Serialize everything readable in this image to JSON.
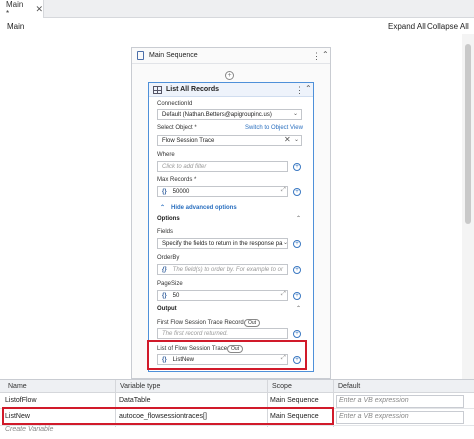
{
  "tab": {
    "label": "Main *",
    "close": "✕"
  },
  "header": {
    "breadcrumb": "Main",
    "expand_all": "Expand All",
    "collapse_all": "Collapse All"
  },
  "main_sequence": {
    "title": "Main Sequence",
    "more": "⋮",
    "collapse": "⌃"
  },
  "activity": {
    "title": "List All Records",
    "connection": {
      "label": "ConnectionId",
      "value": "Default (Nathan.Betters@apigroupinc.us)"
    },
    "select_object": {
      "label": "Select Object *",
      "switch_link": "Switch to Object View",
      "value": "Flow Session Trace"
    },
    "where": {
      "label": "Where",
      "placeholder": "Click to add filter"
    },
    "max_records": {
      "label": "Max Records *",
      "value": "50000"
    },
    "hide_advanced": "Hide advanced options",
    "options_section": "Options",
    "fields": {
      "label": "Fields",
      "value": "Specify the fields to return in the response pa"
    },
    "orderby": {
      "label": "OrderBy",
      "placeholder": "The field(s) to order by. For example to or"
    },
    "pagesize": {
      "label": "PageSize",
      "value": "50"
    },
    "output_section": "Output",
    "first_record": {
      "label": "First Flow Session Trace Record",
      "badge": "Out",
      "placeholder": "The first record returned."
    },
    "list_of": {
      "label": "List of Flow Session Trace",
      "badge": "Out",
      "value": "ListNew"
    }
  },
  "variables": {
    "columns": [
      "Name",
      "Variable type",
      "Scope",
      "Default"
    ],
    "rows": [
      {
        "name": "ListofFlow",
        "type": "DataTable",
        "scope": "Main Sequence",
        "default": "Enter a VB expression"
      },
      {
        "name": "ListNew",
        "type": "autocoe_flowsessiontraces[]",
        "scope": "Main Sequence",
        "default": "Enter a VB expression"
      }
    ],
    "create": "Create Variable"
  }
}
